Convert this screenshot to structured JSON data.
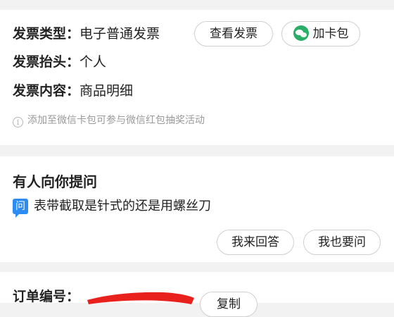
{
  "invoice": {
    "type_label": "发票类型：",
    "type_value": "电子普通发票",
    "title_label": "发票抬头：",
    "title_value": "个人",
    "content_label": "发票内容：",
    "content_value": "商品明细",
    "view_button": "查看发票",
    "add_card_button": "加卡包",
    "hint": "添加至微信卡包可参与微信红包抽奖活动",
    "icons": {
      "add_card": "wechat-icon",
      "hint": "info-icon"
    }
  },
  "qa": {
    "title": "有人向你提问",
    "badge": "问",
    "question": "表带截取是针式的还是用螺丝刀",
    "answer_button": "我来回答",
    "ask_button": "我也要问"
  },
  "order": {
    "number_label": "订单编号：",
    "copy_button": "复制"
  },
  "colors": {
    "background": "#f2f2f2",
    "card": "#ffffff",
    "wechat_green": "#2aae67",
    "question_blue": "#2c8cf3",
    "redaction": "#e8211c"
  }
}
